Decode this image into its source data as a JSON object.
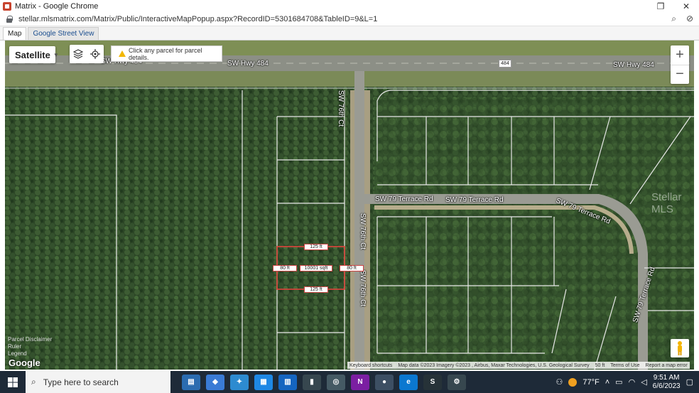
{
  "window": {
    "title": "Matrix - Google Chrome",
    "url": "stellar.mlsmatrix.com/Matrix/Public/InteractiveMapPopup.aspx?RecordID=5301684708&TableID=9&L=1"
  },
  "tabs": [
    {
      "label": "Map"
    },
    {
      "label": "Google Street View"
    }
  ],
  "map": {
    "type_selector": "Satellite",
    "notice": "Click any parcel for parcel details.",
    "zoom_in": "+",
    "zoom_out": "−",
    "roads": {
      "hwy_top_left": "SW Hwy 484",
      "hwy_mid": "SW Hwy 484",
      "hwy_right": "SW Hwy 484",
      "hwy_shield": "484",
      "ct_top": "SW 76th Ct",
      "ct_mid": "SW 76th Ct",
      "ct_low": "SW 76th Ct",
      "terrace_left": "SW 79 Terrace Rd",
      "terrace_mid": "SW 79 Terrace Rd",
      "terrace_curve": "SW 79 Terrace Rd",
      "terrace_vertical": "SW 79 Terrace Rd"
    },
    "parcel": {
      "top_width": "125 ft",
      "bottom_width": "125 ft",
      "left_depth": "80 ft",
      "right_depth": "80 ft",
      "area": "10001 sqft"
    },
    "watermark": "Stellar MLS",
    "legend": [
      "Parcel Disclaimer",
      "Ruler",
      "Legend"
    ],
    "google_logo": "Google",
    "attribution": {
      "shortcuts": "Keyboard shortcuts",
      "data": "Map data ©2023 Imagery ©2023 , Airbus, Maxar Technologies, U.S. Geological Survey",
      "scale": "50 ft",
      "terms": "Terms of Use",
      "report": "Report a map error"
    }
  },
  "taskbar": {
    "search_placeholder": "Type here to search",
    "temperature": "77°F",
    "time": "9:51 AM",
    "date": "6/6/2023"
  }
}
